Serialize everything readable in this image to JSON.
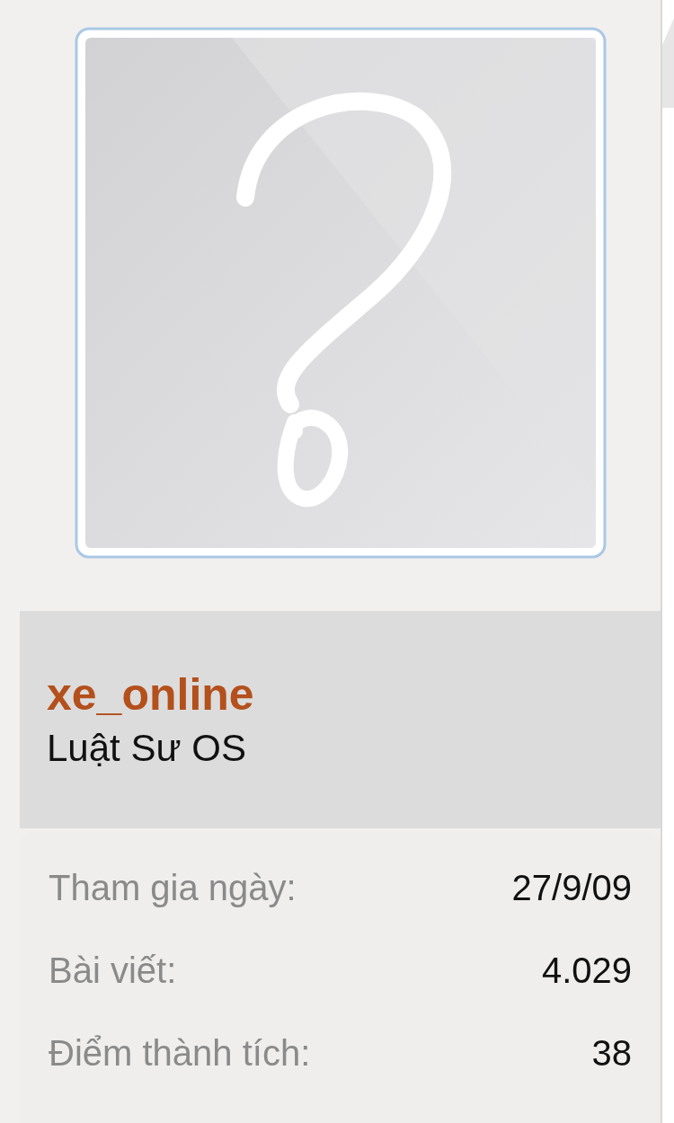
{
  "user": {
    "name": "xe_online",
    "title": "Luật Sư OS"
  },
  "stats": [
    {
      "label": "Tham gia ngày:",
      "value": "27/9/09"
    },
    {
      "label": "Bài viết:",
      "value": "4.029"
    },
    {
      "label": "Điểm thành tích:",
      "value": "38"
    }
  ]
}
